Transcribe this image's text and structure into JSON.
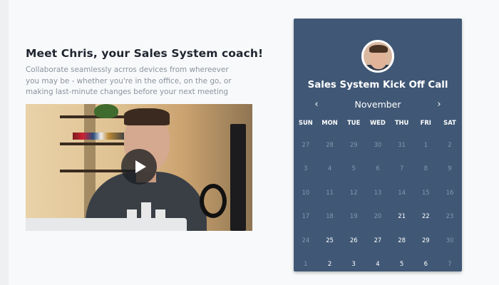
{
  "intro": {
    "title": "Meet Chris, your Sales System coach!",
    "text": "Collaborate seamlessly acrros devices from whereever you may be - whether you're in the office, on the go, or making last-minute changes before your next meeting"
  },
  "video": {
    "play_icon": "play-icon"
  },
  "calendar": {
    "title": "Sales System Kick Off Call",
    "month": "November",
    "prev_icon": "‹",
    "next_icon": "›",
    "weekdays": [
      "SUN",
      "MON",
      "TUE",
      "WED",
      "THU",
      "FRI",
      "SAT"
    ],
    "weeks": [
      [
        {
          "d": "27",
          "a": false
        },
        {
          "d": "28",
          "a": false
        },
        {
          "d": "29",
          "a": false
        },
        {
          "d": "30",
          "a": false
        },
        {
          "d": "31",
          "a": false
        },
        {
          "d": "1",
          "a": false
        },
        {
          "d": "2",
          "a": false
        }
      ],
      [
        {
          "d": "3",
          "a": false
        },
        {
          "d": "4",
          "a": false
        },
        {
          "d": "5",
          "a": false
        },
        {
          "d": "6",
          "a": false
        },
        {
          "d": "7",
          "a": false
        },
        {
          "d": "8",
          "a": false
        },
        {
          "d": "9",
          "a": false
        }
      ],
      [
        {
          "d": "10",
          "a": false
        },
        {
          "d": "11",
          "a": false
        },
        {
          "d": "12",
          "a": false
        },
        {
          "d": "13",
          "a": false
        },
        {
          "d": "14",
          "a": false
        },
        {
          "d": "15",
          "a": false
        },
        {
          "d": "16",
          "a": false
        }
      ],
      [
        {
          "d": "17",
          "a": false
        },
        {
          "d": "18",
          "a": false
        },
        {
          "d": "19",
          "a": false
        },
        {
          "d": "20",
          "a": false
        },
        {
          "d": "21",
          "a": true
        },
        {
          "d": "22",
          "a": true
        },
        {
          "d": "23",
          "a": false
        }
      ],
      [
        {
          "d": "24",
          "a": false
        },
        {
          "d": "25",
          "a": true
        },
        {
          "d": "26",
          "a": true
        },
        {
          "d": "27",
          "a": true
        },
        {
          "d": "28",
          "a": true
        },
        {
          "d": "29",
          "a": true
        },
        {
          "d": "30",
          "a": false
        }
      ],
      [
        {
          "d": "1",
          "a": false
        },
        {
          "d": "2",
          "a": true
        },
        {
          "d": "3",
          "a": true
        },
        {
          "d": "4",
          "a": true
        },
        {
          "d": "5",
          "a": true
        },
        {
          "d": "6",
          "a": true
        },
        {
          "d": "7",
          "a": false
        }
      ]
    ],
    "colors": {
      "card_bg": "#405876",
      "available": "#ffffff",
      "unavailable": "#8597ad"
    }
  }
}
